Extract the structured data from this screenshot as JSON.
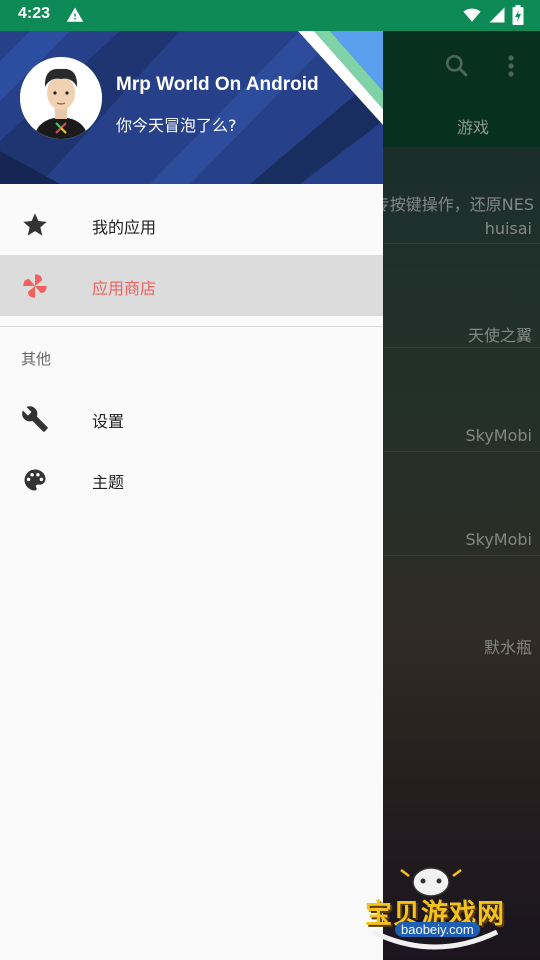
{
  "status_bar": {
    "time": "4:23"
  },
  "background_app": {
    "tab_label": "游戏",
    "rows": [
      {
        "line1": "专按键操作，还原NES",
        "line2": "huisai"
      },
      {
        "line1": "",
        "line2": "天使之翼"
      },
      {
        "line1": "",
        "line2": "SkyMobi"
      },
      {
        "line1": "",
        "line2": "SkyMobi"
      },
      {
        "line1": "",
        "line2": "默水瓶"
      }
    ],
    "watermark": {
      "title": "宝贝游戏网",
      "url": "baobeiy.com"
    }
  },
  "drawer": {
    "header": {
      "name": "Mrp World On Android",
      "subtitle": "你今天冒泡了么?"
    },
    "menu": [
      {
        "label": "我的应用",
        "icon": "star-icon",
        "active": false
      },
      {
        "label": "应用商店",
        "icon": "pinwheel-icon",
        "active": true
      }
    ],
    "section": {
      "title": "其他"
    },
    "other_menu": [
      {
        "label": "设置",
        "icon": "wrench-icon"
      },
      {
        "label": "主题",
        "icon": "palette-icon"
      }
    ]
  },
  "colors": {
    "status_bar": "#0d8a56",
    "toolbar": "#0b4a32",
    "accent": "#f0625e",
    "header": "#243a7a"
  }
}
